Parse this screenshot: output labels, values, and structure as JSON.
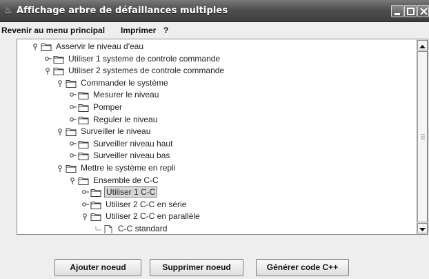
{
  "window": {
    "title": "Affichage arbre de défaillances multiples",
    "minimize_icon": "minimize-icon",
    "maximize_icon": "maximize-icon",
    "close_icon": "close-icon"
  },
  "menubar": {
    "items": [
      "Revenir au menu principal",
      "Imprimer",
      "?"
    ]
  },
  "tree": {
    "nodes": [
      {
        "label": "Asservir le niveau d'eau",
        "depth": 0,
        "expanded": true,
        "type": "folder"
      },
      {
        "label": "Utiliser 1 systeme de controle commande",
        "depth": 1,
        "expanded": false,
        "type": "folder"
      },
      {
        "label": "Utiliser 2 systemes de controle commande",
        "depth": 1,
        "expanded": true,
        "type": "folder"
      },
      {
        "label": "Commander le système",
        "depth": 2,
        "expanded": true,
        "type": "folder"
      },
      {
        "label": "Mesurer le niveau",
        "depth": 3,
        "expanded": false,
        "type": "folder"
      },
      {
        "label": "Pomper",
        "depth": 3,
        "expanded": false,
        "type": "folder"
      },
      {
        "label": "Reguler le niveau",
        "depth": 3,
        "expanded": false,
        "type": "folder"
      },
      {
        "label": "Surveiller le niveau",
        "depth": 2,
        "expanded": true,
        "type": "folder"
      },
      {
        "label": "Surveiller niveau haut",
        "depth": 3,
        "expanded": false,
        "type": "folder"
      },
      {
        "label": "Surveiller niveau bas",
        "depth": 3,
        "expanded": false,
        "type": "folder"
      },
      {
        "label": "Mettre le système en repli",
        "depth": 2,
        "expanded": true,
        "type": "folder"
      },
      {
        "label": "Ensemble de C-C",
        "depth": 3,
        "expanded": true,
        "type": "folder"
      },
      {
        "label": "Utiliser 1 C-C",
        "depth": 4,
        "expanded": false,
        "type": "folder",
        "selected": true
      },
      {
        "label": "Utiliser 2 C-C en série",
        "depth": 4,
        "expanded": false,
        "type": "folder"
      },
      {
        "label": "Utiliser 2 C-C en parallèle",
        "depth": 4,
        "expanded": true,
        "type": "folder"
      },
      {
        "label": "C-C standard",
        "depth": 5,
        "expanded": false,
        "type": "leaf"
      }
    ]
  },
  "buttons": {
    "add": "Ajouter noeud",
    "delete": "Supprimer noeud",
    "generate": "Générer code C++"
  },
  "colors": {
    "titlebar": "#4f4f4f",
    "selection": "#d6d6d6"
  }
}
